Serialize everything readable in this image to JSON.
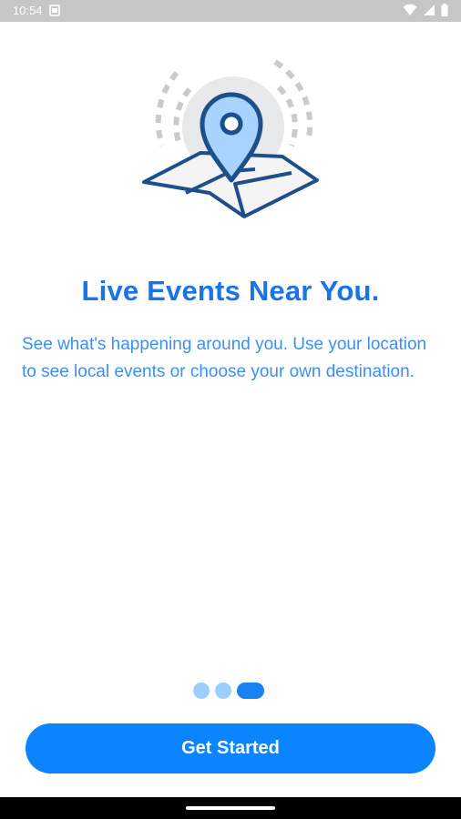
{
  "status_bar": {
    "time": "10:54",
    "left_icons": [
      "screenshot-icon"
    ],
    "right_icons": [
      "wifi-icon",
      "cellular-signal-icon",
      "battery-icon"
    ]
  },
  "onboarding": {
    "illustration": "location-pin-on-map-icon",
    "title": "Live Events Near You.",
    "description": "See what's happening around you. Use your location to see local events or choose your own destination.",
    "page_count": 3,
    "current_page": 3
  },
  "actions": {
    "get_started_label": "Get Started"
  },
  "colors": {
    "accent": "#0a84ff",
    "title": "#1a73e8",
    "description": "#3d8ff0",
    "dot_inactive": "#9ccffb",
    "dot_active": "#1782f0",
    "illustration_navy": "#1d4f8a",
    "illustration_fill": "#a9d3ff"
  }
}
